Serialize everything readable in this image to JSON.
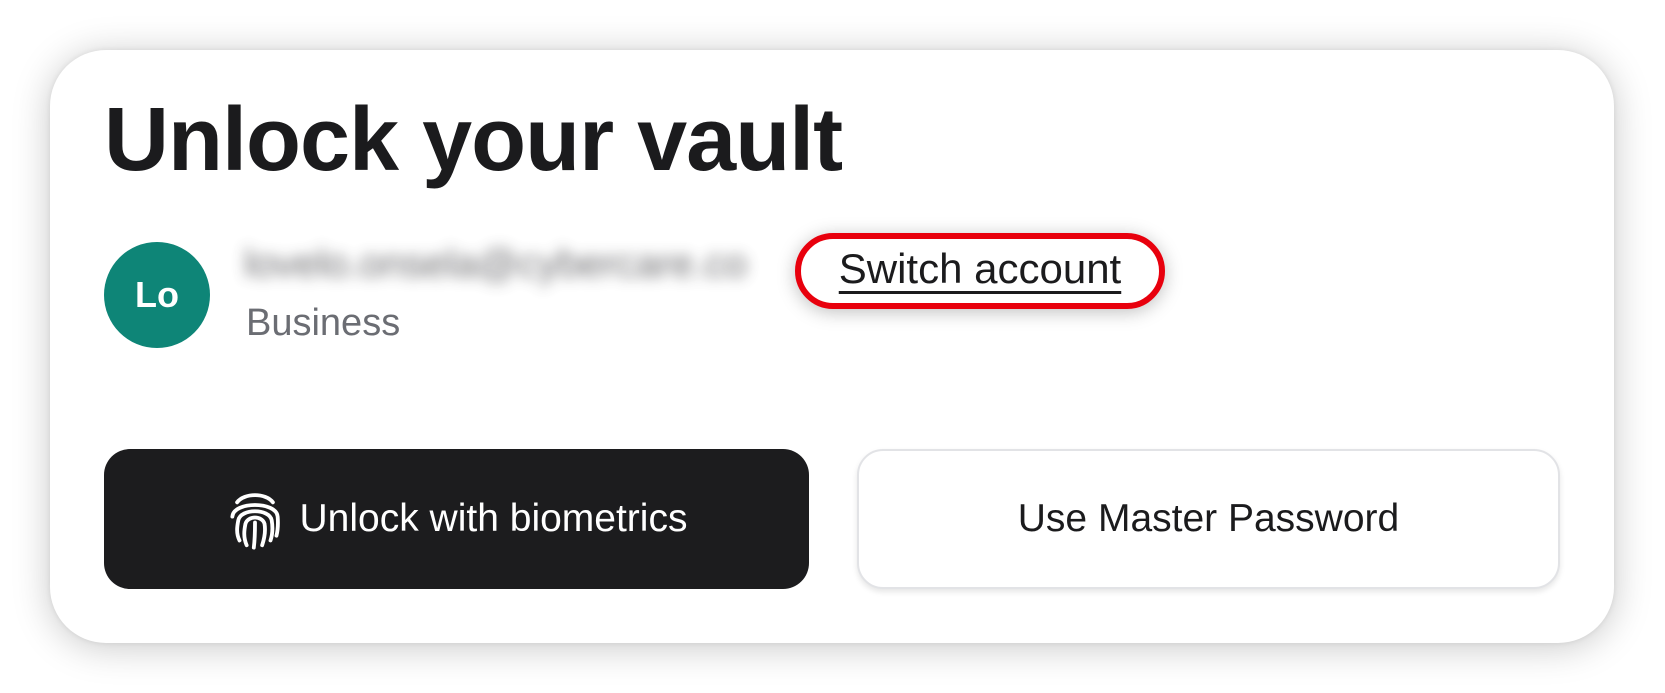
{
  "header": {
    "title": "Unlock your vault"
  },
  "account": {
    "avatar_initials": "Lo",
    "email_blurred": "lovelo.onsela@cybercare.co",
    "plan": "Business",
    "switch_account_label": "Switch account",
    "avatar_color": "#0e8577"
  },
  "actions": {
    "biometrics_label": "Unlock with biometrics",
    "biometrics_icon": "fingerprint-icon",
    "master_password_label": "Use Master Password"
  },
  "highlight": {
    "target": "switch-account-link",
    "color": "#e8000d"
  }
}
